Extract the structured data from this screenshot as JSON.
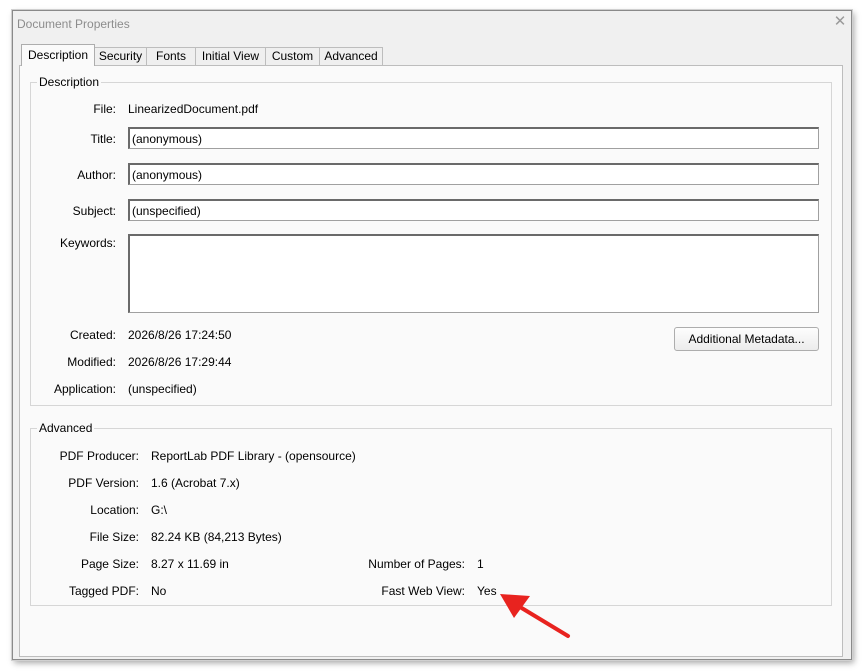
{
  "window": {
    "title": "Document Properties",
    "close_glyph": "✕"
  },
  "tabs": [
    {
      "label": "Description"
    },
    {
      "label": "Security"
    },
    {
      "label": "Fonts"
    },
    {
      "label": "Initial View"
    },
    {
      "label": "Custom"
    },
    {
      "label": "Advanced"
    }
  ],
  "description": {
    "group_label": "Description",
    "file_label": "File:",
    "file_value": "LinearizedDocument.pdf",
    "title_label": "Title:",
    "title_value": "(anonymous)",
    "author_label": "Author:",
    "author_value": "(anonymous)",
    "subject_label": "Subject:",
    "subject_value": "(unspecified)",
    "keywords_label": "Keywords:",
    "keywords_value": "",
    "created_label": "Created:",
    "created_value": "2026/8/26 17:24:50",
    "modified_label": "Modified:",
    "modified_value": "2026/8/26 17:29:44",
    "application_label": "Application:",
    "application_value": "(unspecified)",
    "metadata_button": "Additional Metadata..."
  },
  "advanced": {
    "group_label": "Advanced",
    "producer_label": "PDF Producer:",
    "producer_value": "ReportLab PDF Library - (opensource)",
    "version_label": "PDF Version:",
    "version_value": "1.6 (Acrobat 7.x)",
    "location_label": "Location:",
    "location_value": "G:\\",
    "filesize_label": "File Size:",
    "filesize_value": "82.24 KB (84,213 Bytes)",
    "pagesize_label": "Page Size:",
    "pagesize_value": "8.27 x 11.69 in",
    "tagged_label": "Tagged PDF:",
    "tagged_value": "No",
    "numpages_label": "Number of Pages:",
    "numpages_value": "1",
    "fastweb_label": "Fast Web View:",
    "fastweb_value": "Yes"
  },
  "annotation": {
    "arrow_color": "#e8231f"
  }
}
